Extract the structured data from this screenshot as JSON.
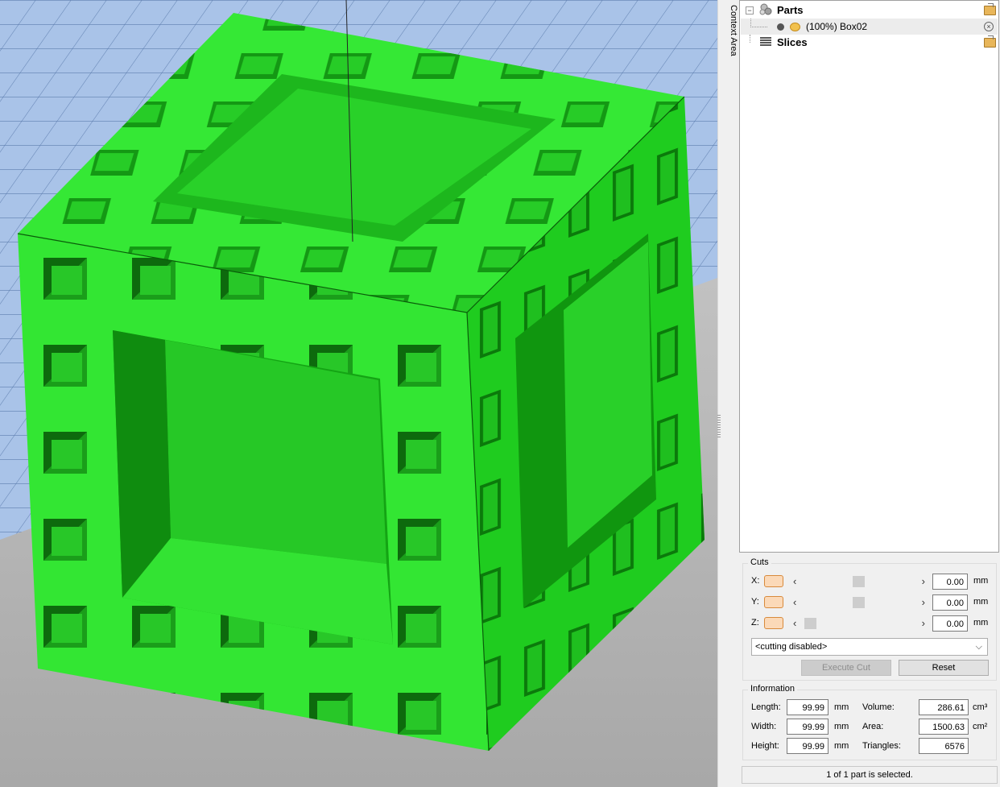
{
  "sidebar": {
    "context_label": "Context Area",
    "tree": {
      "parts_label": "Parts",
      "part_item": {
        "percent": "(100%)",
        "name": "Box02"
      },
      "slices_label": "Slices"
    }
  },
  "cuts": {
    "title": "Cuts",
    "axes": [
      {
        "label": "X:",
        "value": "0.00",
        "unit": "mm",
        "slider_position": 0.5
      },
      {
        "label": "Y:",
        "value": "0.00",
        "unit": "mm",
        "slider_position": 0.5
      },
      {
        "label": "Z:",
        "value": "0.00",
        "unit": "mm",
        "slider_position": 0.0
      }
    ],
    "mode": "<cutting disabled>",
    "execute_label": "Execute Cut",
    "reset_label": "Reset"
  },
  "information": {
    "title": "Information",
    "length_label": "Length:",
    "length": "99.99",
    "length_unit": "mm",
    "width_label": "Width:",
    "width": "99.99",
    "width_unit": "mm",
    "height_label": "Height:",
    "height": "99.99",
    "height_unit": "mm",
    "volume_label": "Volume:",
    "volume": "286.61",
    "volume_unit": "cm³",
    "area_label": "Area:",
    "area": "1500.63",
    "area_unit": "cm²",
    "triangles_label": "Triangles:",
    "triangles": "6576"
  },
  "status": "1 of 1 part is selected.",
  "colors": {
    "model_green": "#2ee52e",
    "build_plate": "#a9c3e8",
    "ground": "#bdbdbd"
  }
}
